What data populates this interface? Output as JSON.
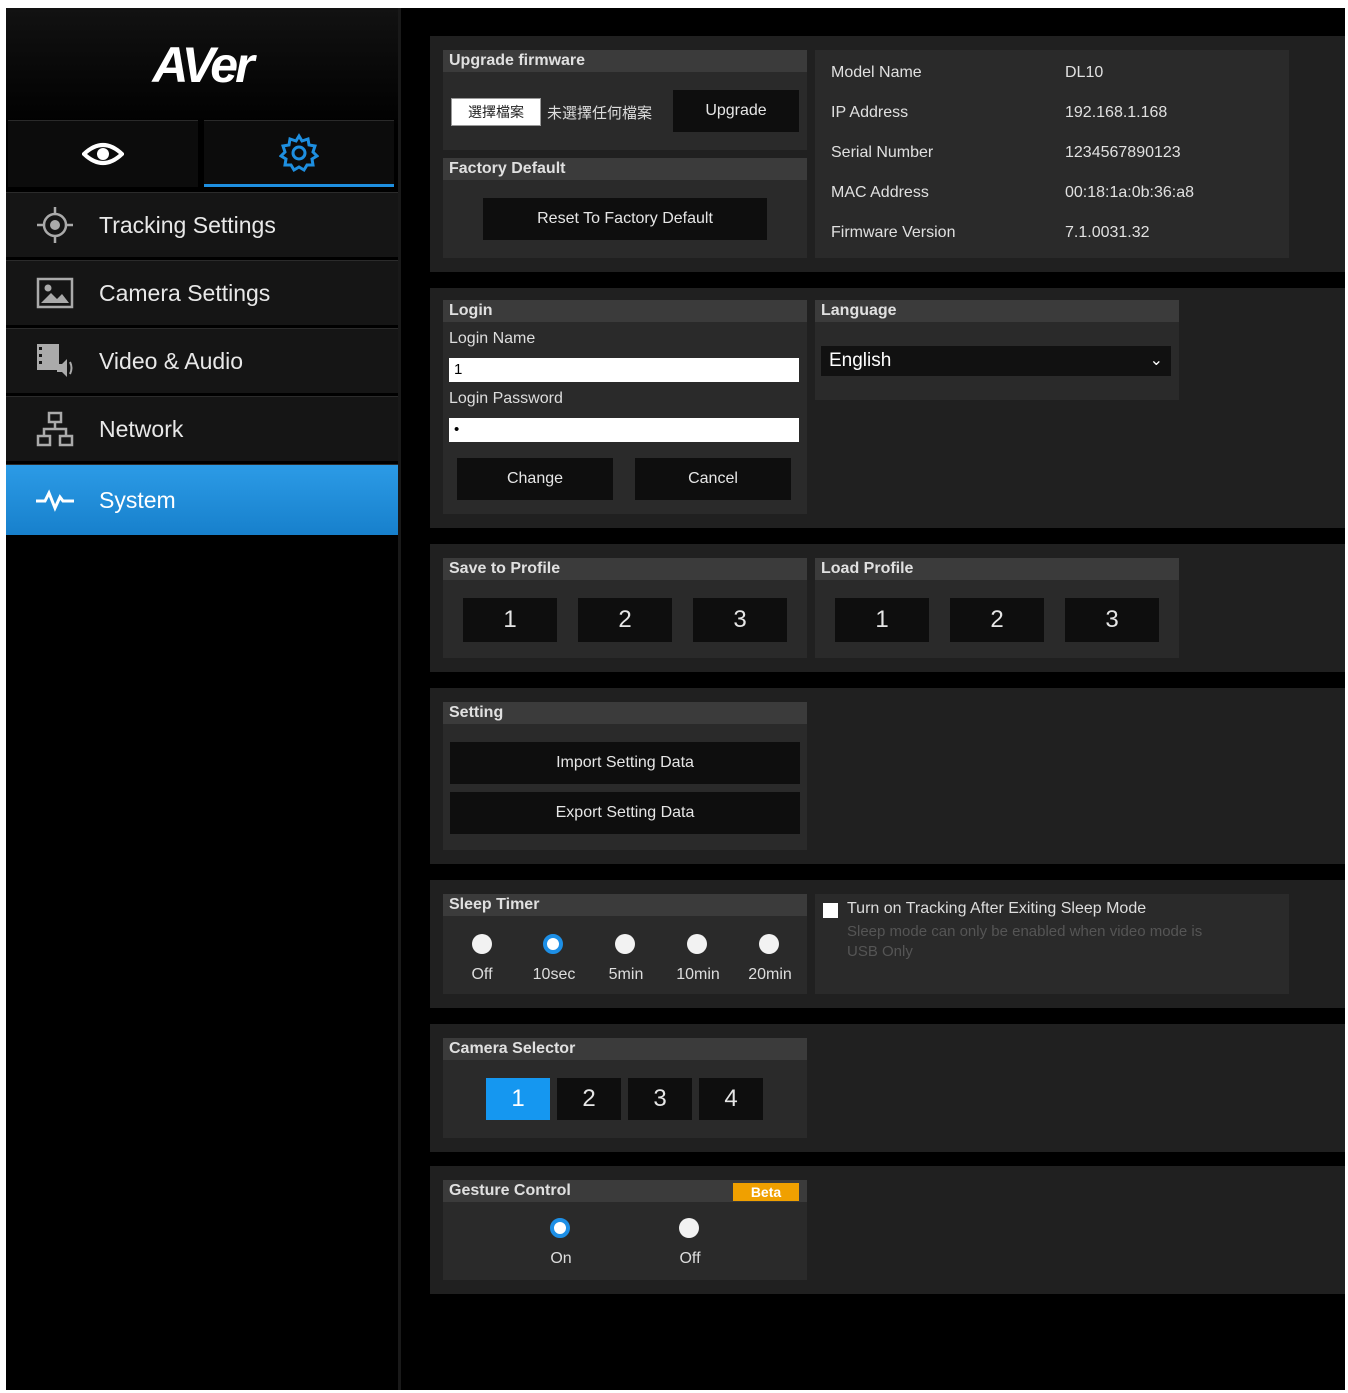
{
  "brand": {
    "logo": "AVer"
  },
  "mode_tabs": {
    "preview_icon": "eye-icon",
    "settings_icon": "gear-icon"
  },
  "nav": [
    {
      "label": "Tracking Settings",
      "icon": "crosshair-icon"
    },
    {
      "label": "Camera Settings",
      "icon": "image-icon"
    },
    {
      "label": "Video & Audio",
      "icon": "video-audio-icon"
    },
    {
      "label": "Network",
      "icon": "network-icon"
    },
    {
      "label": "System",
      "icon": "pulse-icon",
      "active": true
    }
  ],
  "upgrade": {
    "title": "Upgrade firmware",
    "choose_file": "選擇檔案",
    "no_file": "未選擇任何檔案",
    "button": "Upgrade"
  },
  "factory": {
    "title": "Factory Default",
    "button": "Reset To Factory Default"
  },
  "info": {
    "rows": [
      {
        "label": "Model Name",
        "value": "DL10"
      },
      {
        "label": "IP Address",
        "value": "192.168.1.168"
      },
      {
        "label": "Serial Number",
        "value": "1234567890123"
      },
      {
        "label": "MAC Address",
        "value": "00:18:1a:0b:36:a8"
      },
      {
        "label": "Firmware Version",
        "value": "7.1.0031.32"
      }
    ]
  },
  "login": {
    "title": "Login",
    "name_label": "Login Name",
    "name_value": "1",
    "password_label": "Login Password",
    "password_value": "•",
    "change": "Change",
    "cancel": "Cancel"
  },
  "language": {
    "title": "Language",
    "selected": "English"
  },
  "save_profile": {
    "title": "Save to Profile",
    "buttons": [
      "1",
      "2",
      "3"
    ]
  },
  "load_profile": {
    "title": "Load Profile",
    "buttons": [
      "1",
      "2",
      "3"
    ]
  },
  "setting": {
    "title": "Setting",
    "import": "Import Setting Data",
    "export": "Export Setting Data"
  },
  "sleep": {
    "title": "Sleep Timer",
    "options": [
      "Off",
      "10sec",
      "5min",
      "10min",
      "20min"
    ],
    "selected": "10sec",
    "checkbox_label": "Turn on Tracking After Exiting Sleep Mode",
    "note_line1": "Sleep mode can only be enabled when video mode is",
    "note_line2": "USB Only"
  },
  "camera_selector": {
    "title": "Camera Selector",
    "buttons": [
      "1",
      "2",
      "3",
      "4"
    ],
    "selected": "1"
  },
  "gesture": {
    "title": "Gesture Control",
    "badge": "Beta",
    "options": [
      "On",
      "Off"
    ],
    "selected": "On"
  },
  "colors": {
    "accent": "#1597f0",
    "beta": "#f0a000"
  }
}
